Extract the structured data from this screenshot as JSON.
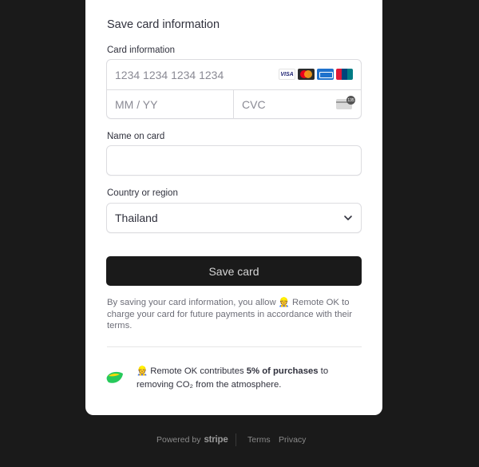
{
  "form": {
    "title": "Save card information",
    "card_label": "Card information",
    "card_number_placeholder": "1234 1234 1234 1234",
    "expiry_placeholder": "MM / YY",
    "cvc_placeholder": "CVC",
    "brands": [
      "visa-logo",
      "mastercard-logo",
      "amex-logo",
      "unionpay-logo"
    ],
    "visa_text": "VISA",
    "name_label": "Name on card",
    "name_value": "",
    "country_label": "Country or region",
    "country_value": "Thailand",
    "save_button": "Save card",
    "consent_text": "By saving your card information, you allow 👷 Remote OK to charge your card for future payments in accordance with their terms.",
    "climate_prefix": "👷 Remote OK contributes ",
    "climate_bold": "5% of purchases",
    "climate_suffix": " to removing CO₂ from the atmosphere."
  },
  "footer": {
    "powered_by": "Powered by",
    "stripe": "stripe",
    "terms": "Terms",
    "privacy": "Privacy"
  },
  "colors": {
    "background": "#1a1a1a",
    "panel": "#ffffff",
    "button": "#1a1a1a",
    "border": "#dcdce0"
  }
}
